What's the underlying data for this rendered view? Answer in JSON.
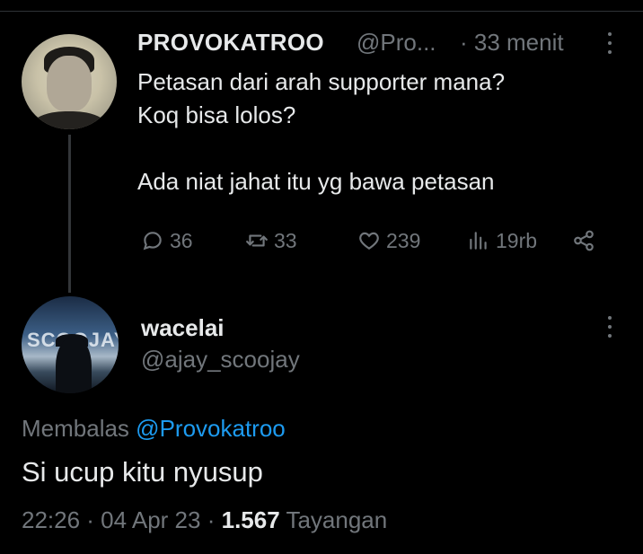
{
  "parent_tweet": {
    "name": "PROVOKATROO",
    "handle": "@Pro...",
    "time": "· 33 menit",
    "lines": [
      "Petasan dari arah supporter mana?",
      "Koq bisa lolos?",
      "",
      "Ada niat jahat itu yg bawa petasan"
    ],
    "actions": {
      "reply_count": "36",
      "retweet_count": "33",
      "like_count": "239",
      "views_count": "19rb"
    }
  },
  "reply_tweet": {
    "name": "wacelai",
    "handle": "@ajay_scoojay",
    "replying_prefix": "Membalas",
    "replying_to": "@Provokatroo",
    "text": "Si ucup kitu nyusup",
    "timestamp": "22:26 · 04 Apr 23 ·",
    "views": "1.567",
    "views_label": "Tayangan"
  },
  "avatar2_text": "SCOOJAY",
  "colors": {
    "background": "#000000",
    "text_primary": "#e7e9ea",
    "text_secondary": "#71767b",
    "accent": "#1d9bf0"
  },
  "icons": [
    "reply-icon",
    "retweet-icon",
    "like-icon",
    "views-icon",
    "share-icon",
    "more-icon"
  ]
}
